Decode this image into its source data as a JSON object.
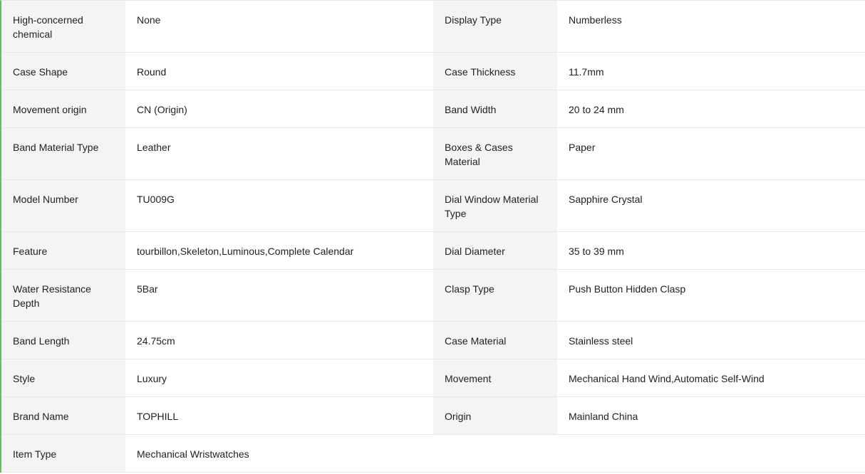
{
  "specs": {
    "rows": [
      {
        "l_label": "High-concerned chemical",
        "l_value": "None",
        "r_label": "Display Type",
        "r_value": "Numberless"
      },
      {
        "l_label": "Case Shape",
        "l_value": "Round",
        "r_label": "Case Thickness",
        "r_value": "11.7mm"
      },
      {
        "l_label": "Movement origin",
        "l_value": "CN (Origin)",
        "r_label": "Band Width",
        "r_value": "20 to 24 mm"
      },
      {
        "l_label": "Band Material Type",
        "l_value": "Leather",
        "r_label": "Boxes & Cases Material",
        "r_value": "Paper"
      },
      {
        "l_label": "Model Number",
        "l_value": "TU009G",
        "r_label": "Dial Window Material Type",
        "r_value": "Sapphire Crystal"
      },
      {
        "l_label": "Feature",
        "l_value": "tourbillon,Skeleton,Luminous,Complete Calendar",
        "r_label": "Dial Diameter",
        "r_value": "35 to 39 mm"
      },
      {
        "l_label": "Water Resistance Depth",
        "l_value": "5Bar",
        "r_label": "Clasp Type",
        "r_value": "Push Button Hidden Clasp"
      },
      {
        "l_label": "Band Length",
        "l_value": "24.75cm",
        "r_label": "Case Material",
        "r_value": "Stainless steel"
      },
      {
        "l_label": "Style",
        "l_value": "Luxury",
        "r_label": "Movement",
        "r_value": "Mechanical Hand Wind,Automatic Self-Wind"
      },
      {
        "l_label": "Brand Name",
        "l_value": "TOPHILL",
        "r_label": "Origin",
        "r_value": "Mainland China"
      },
      {
        "l_label": "Item Type",
        "l_value": "Mechanical Wristwatches",
        "r_label": "",
        "r_value": ""
      }
    ]
  },
  "colors": {
    "accent_border": "#5cc35a",
    "label_bg": "#f4f4f4",
    "divider": "#e8e8e8"
  }
}
